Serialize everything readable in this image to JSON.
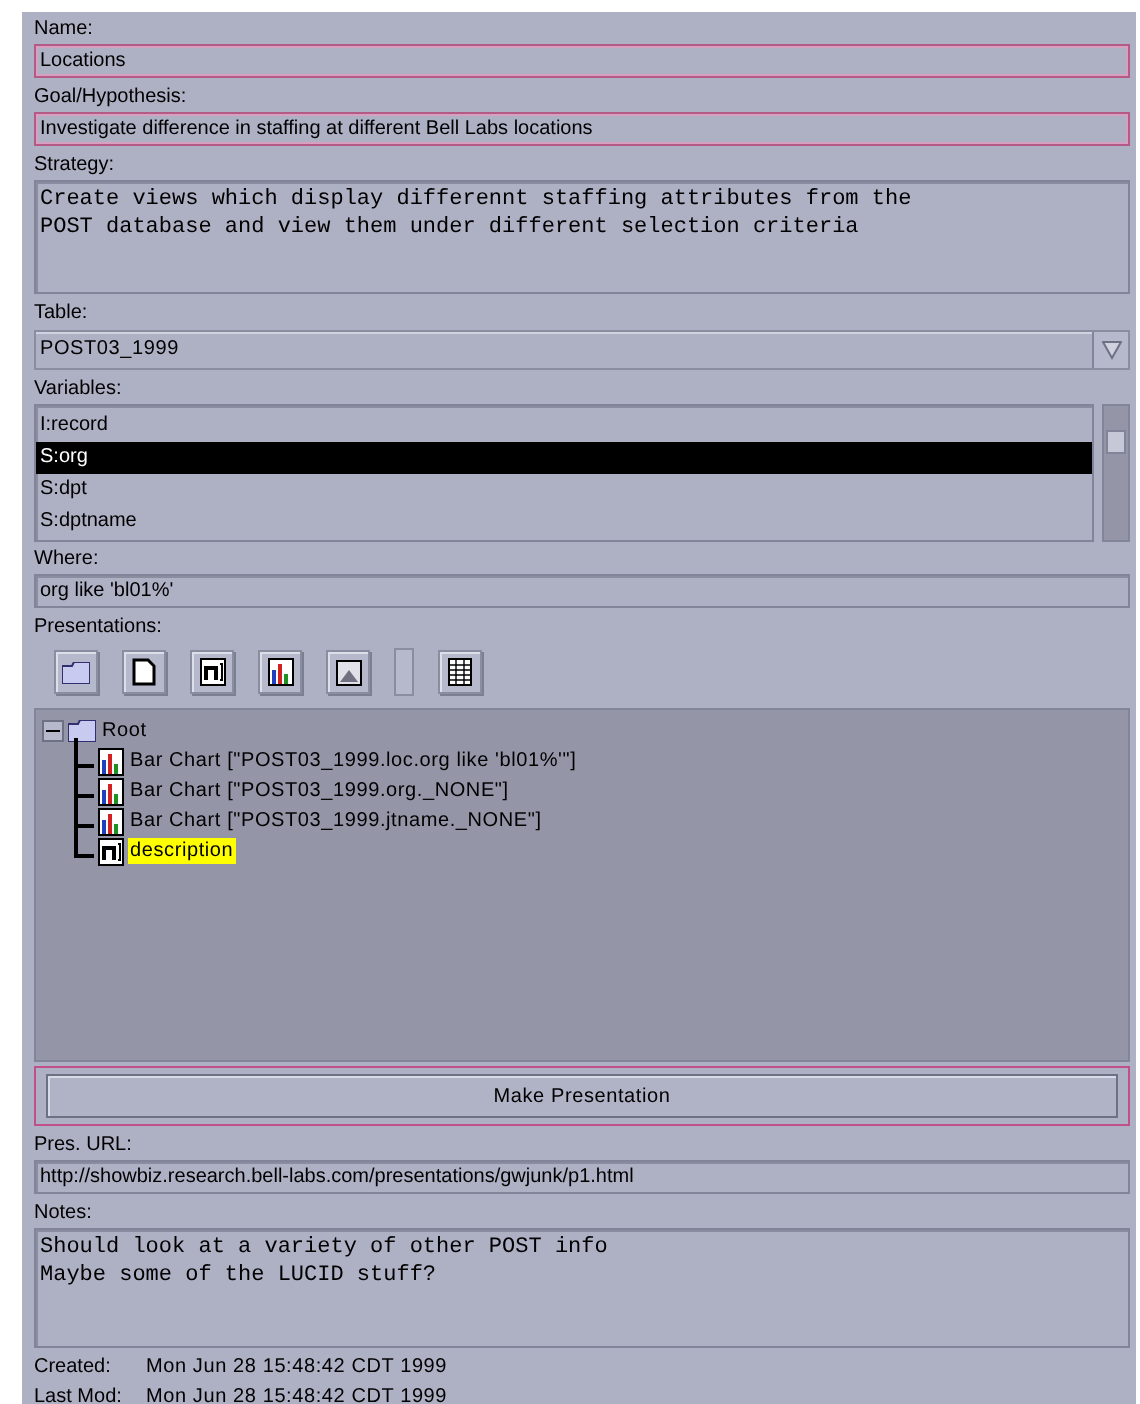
{
  "name": {
    "label": "Name:",
    "value": "Locations",
    "highlighted": true
  },
  "goal": {
    "label": "Goal/Hypothesis:",
    "value": "Investigate difference in staffing at different Bell Labs locations",
    "highlighted": true
  },
  "strategy": {
    "label": "Strategy:",
    "value": "Create views which display differennt staffing attributes from the\nPOST database and view them under different selection criteria"
  },
  "table": {
    "label": "Table:",
    "value": "POST03_1999"
  },
  "variables": {
    "label": "Variables:",
    "items": [
      {
        "text": "I:record",
        "selected": false
      },
      {
        "text": "S:org",
        "selected": true
      },
      {
        "text": "S:dpt",
        "selected": false
      },
      {
        "text": "S:dptname",
        "selected": false
      }
    ]
  },
  "where": {
    "label": "Where:",
    "value": "org like 'bl01%'",
    "highlighted": false
  },
  "presentations": {
    "label": "Presentations:",
    "tools": [
      {
        "kind": "folder"
      },
      {
        "kind": "page"
      },
      {
        "kind": "note"
      },
      {
        "kind": "bar-chart"
      },
      {
        "kind": "image"
      },
      {
        "kind": "separator"
      },
      {
        "kind": "table"
      }
    ],
    "tree": {
      "text": "Root",
      "expanded": true,
      "children": [
        {
          "kind": "bar-chart",
          "text": "Bar Chart [\"POST03_1999.loc.org like 'bl01%'\"]",
          "selected": false
        },
        {
          "kind": "bar-chart",
          "text": "Bar Chart [\"POST03_1999.org._NONE\"]",
          "selected": false
        },
        {
          "kind": "bar-chart",
          "text": "Bar Chart [\"POST03_1999.jtname._NONE\"]",
          "selected": false
        },
        {
          "kind": "note",
          "text": "description",
          "selected": true
        }
      ]
    }
  },
  "make_button": {
    "label": "Make Presentation",
    "highlighted": true
  },
  "url": {
    "label": "Pres. URL:",
    "value": "http://showbiz.research.bell-labs.com/presentations/gwjunk/p1.html",
    "highlighted": false
  },
  "notes": {
    "label": "Notes:",
    "value": "Should look at a variety of other POST info\nMaybe some of the LUCID stuff?"
  },
  "footer": [
    {
      "label": "Created:",
      "value": "Mon Jun 28 15:48:42 CDT 1999"
    },
    {
      "label": "Last Mod:",
      "value": "Mon Jun 28 15:48:42 CDT 1999"
    }
  ]
}
